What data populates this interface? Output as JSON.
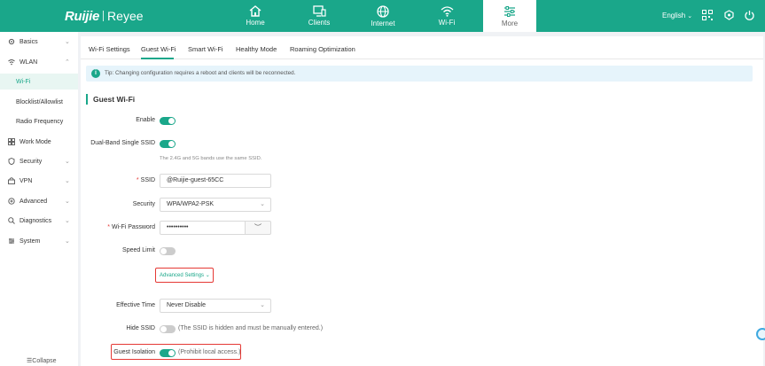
{
  "brand": {
    "name": "Ruijie",
    "sub": "Reyee"
  },
  "colors": {
    "accent": "#1aa78a",
    "required": "#e53935",
    "highlight_box": "#e53935"
  },
  "nav": [
    {
      "label": "Home",
      "icon": "home-icon"
    },
    {
      "label": "Clients",
      "icon": "clients-icon"
    },
    {
      "label": "Internet",
      "icon": "globe-icon"
    },
    {
      "label": "Wi-Fi",
      "icon": "wifi-icon"
    },
    {
      "label": "More",
      "icon": "sliders-icon",
      "active": true
    }
  ],
  "header": {
    "language": "English"
  },
  "sidebar": {
    "items": [
      {
        "label": "Basics",
        "icon": "gear-icon"
      },
      {
        "label": "WLAN",
        "icon": "wifi-icon"
      },
      {
        "label": "Wi-Fi",
        "active": true
      },
      {
        "label": "Blocklist/Allowlist"
      },
      {
        "label": "Radio Frequency"
      },
      {
        "label": "Work Mode",
        "icon": "grid-icon"
      },
      {
        "label": "Security",
        "icon": "shield-icon"
      },
      {
        "label": "VPN",
        "icon": "vpn-icon"
      },
      {
        "label": "Advanced",
        "icon": "advanced-icon"
      },
      {
        "label": "Diagnostics",
        "icon": "diagnostics-icon"
      },
      {
        "label": "System",
        "icon": "system-icon"
      }
    ],
    "collapse": "Collapse"
  },
  "tabs": [
    {
      "label": "Wi-Fi Settings"
    },
    {
      "label": "Guest Wi-Fi",
      "active": true
    },
    {
      "label": "Smart Wi-Fi"
    },
    {
      "label": "Healthy Mode"
    },
    {
      "label": "Roaming Optimization"
    }
  ],
  "tip": "Tip: Changing configuration requires a reboot and clients will be reconnected.",
  "section_title": "Guest Wi-Fi",
  "form": {
    "enable": {
      "label": "Enable",
      "on": true
    },
    "dual_band": {
      "label": "Dual-Band Single SSID",
      "on": true,
      "hint": "The 2.4G and 5G bands use the same SSID."
    },
    "ssid": {
      "label": "SSID",
      "value": "@Ruijie-guest-65CC"
    },
    "security": {
      "label": "Security",
      "value": "WPA/WPA2-PSK"
    },
    "password": {
      "label": "Wi-Fi Password",
      "value": "••••••••••"
    },
    "speed_limit": {
      "label": "Speed Limit",
      "on": false
    },
    "advanced": "Advanced Settings",
    "effective_time": {
      "label": "Effective Time",
      "value": "Never Disable"
    },
    "hide_ssid": {
      "label": "Hide SSID",
      "on": false,
      "note": "(The SSID is hidden and must be manually entered.)"
    },
    "guest_isolation": {
      "label": "Guest Isolation",
      "on": true,
      "note": "(Prohibit local access.)"
    }
  }
}
